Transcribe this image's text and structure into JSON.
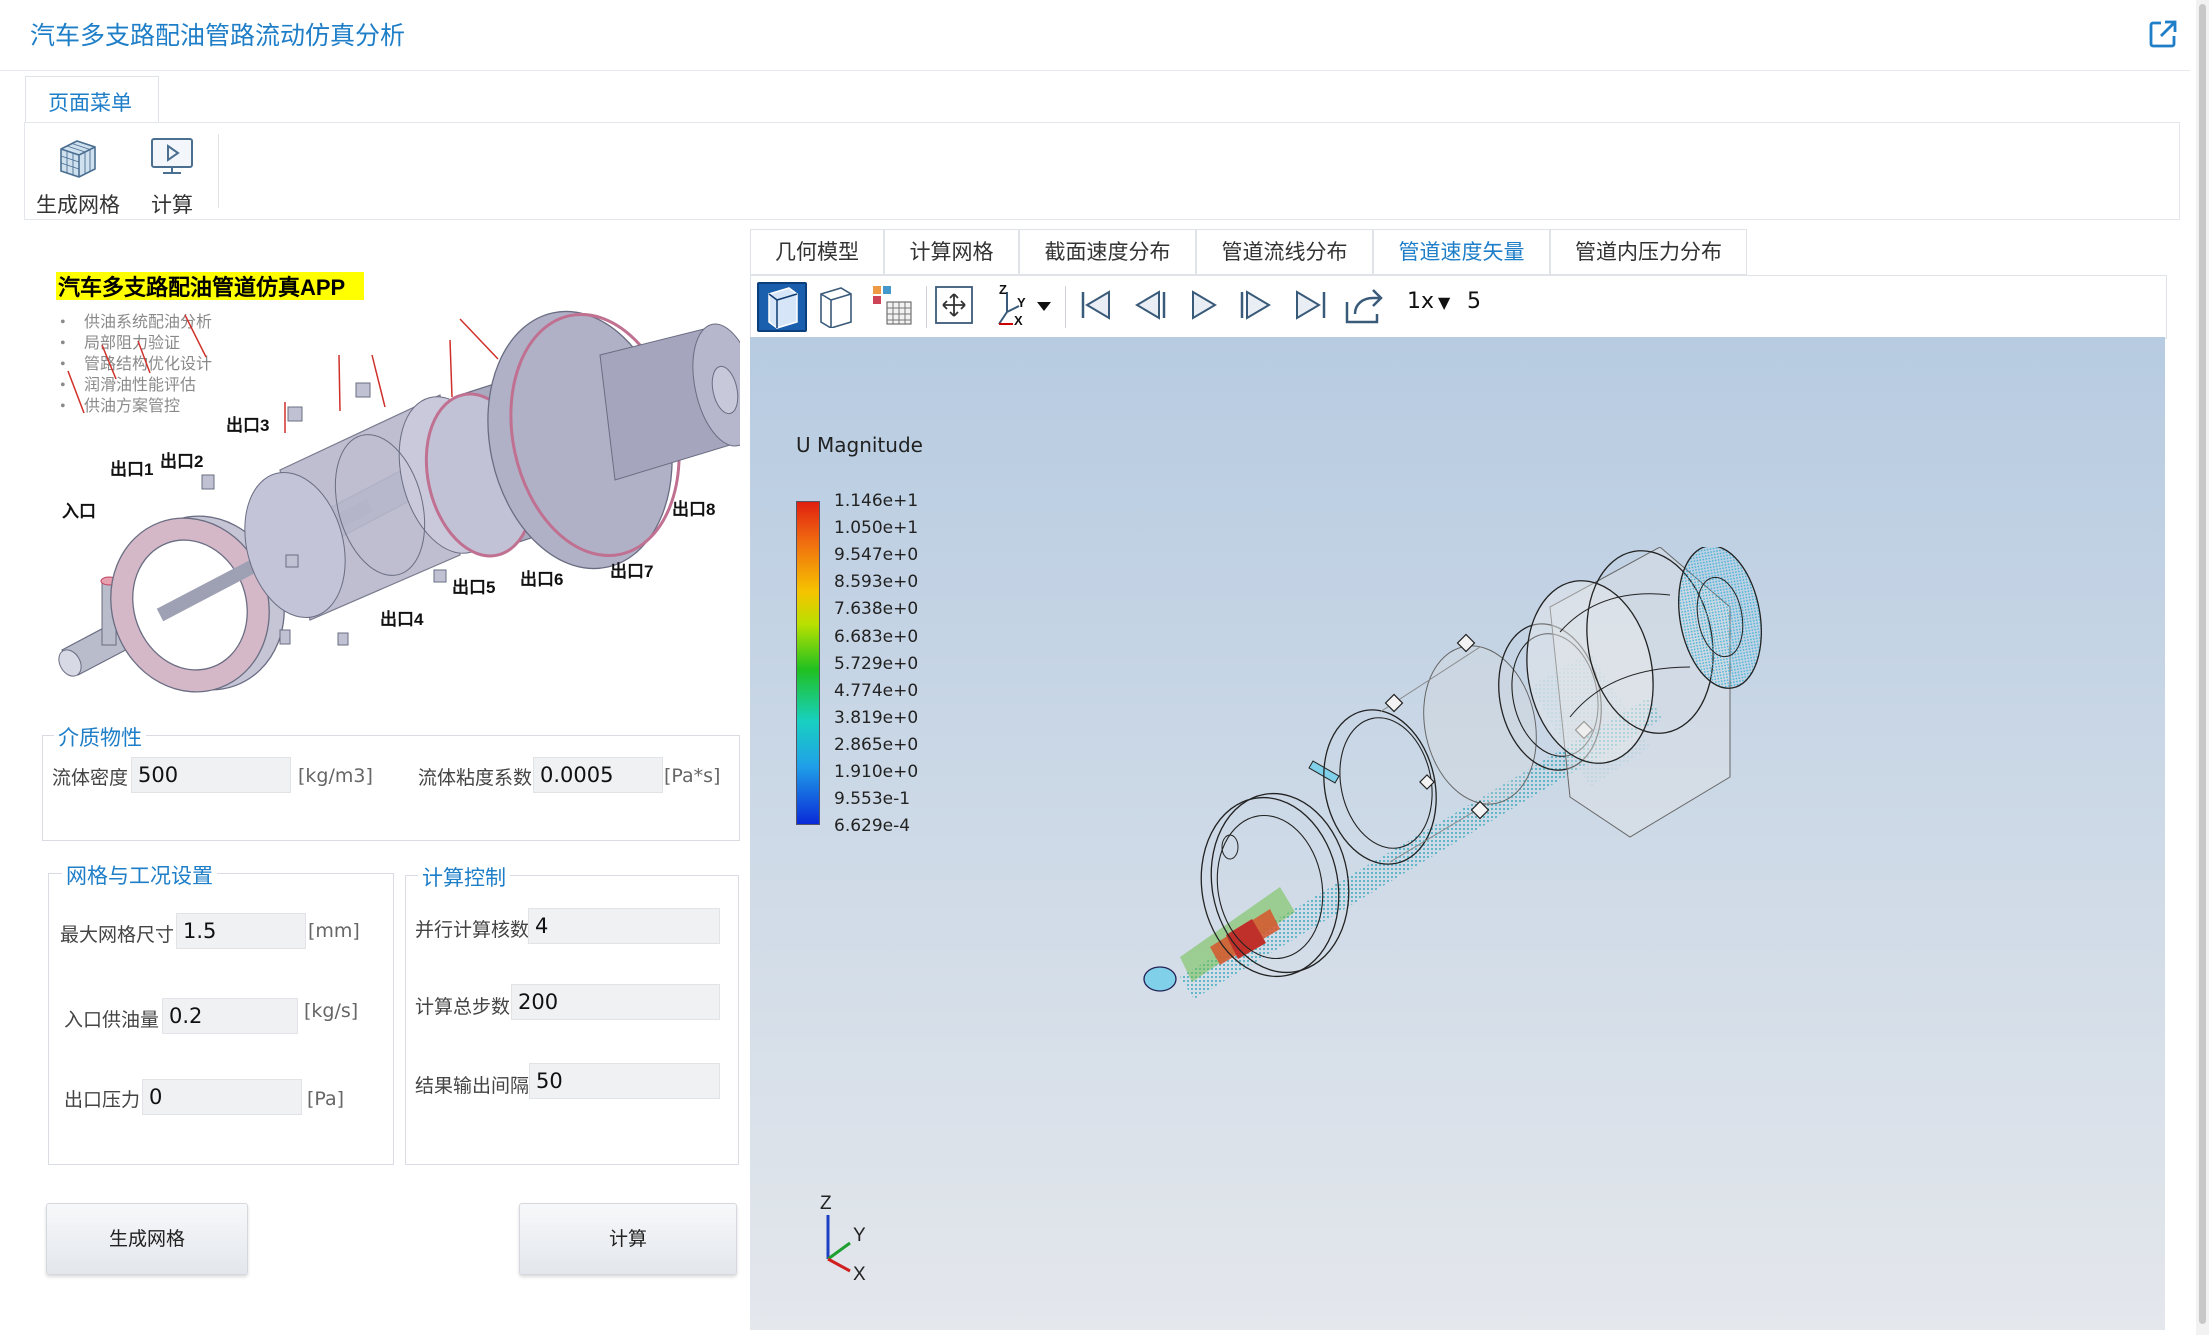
{
  "app": {
    "title": "汽车多支路配油管路流动仿真分析"
  },
  "menu": {
    "tab_label": "页面菜单",
    "buttons": [
      {
        "label": "生成网格",
        "icon": "mesh-cube-icon"
      },
      {
        "label": "计算",
        "icon": "compute-monitor-icon"
      }
    ]
  },
  "intro": {
    "title": "汽车多支路配油管道仿真APP",
    "bullets": [
      "供油系统配油分析",
      "局部阻力验证",
      "管路结构优化设计",
      "润滑油性能评估",
      "供油方案管控"
    ],
    "labels": {
      "inlet": "入口",
      "out1": "出口1",
      "out2": "出口2",
      "out3": "出口3",
      "out4": "出口4",
      "out5": "出口5",
      "out6": "出口6",
      "out7": "出口7",
      "out8": "出口8"
    }
  },
  "medium": {
    "title": "介质物性",
    "density": {
      "label": "流体密度",
      "value": "500",
      "unit": "[kg/m3]"
    },
    "viscosity": {
      "label": "流体粘度系数",
      "value": "0.0005",
      "unit": "[Pa*s]"
    }
  },
  "mesh_settings": {
    "title": "网格与工况设置",
    "max_mesh": {
      "label": "最大网格尺寸",
      "value": "1.5",
      "unit": "[mm]"
    },
    "inlet_flow": {
      "label": "入口供油量",
      "value": "0.2",
      "unit": "[kg/s]"
    },
    "outlet_pressure": {
      "label": "出口压力",
      "value": "0",
      "unit": "[Pa]"
    }
  },
  "calc_control": {
    "title": "计算控制",
    "cores": {
      "label": "并行计算核数",
      "value": "4"
    },
    "total_steps": {
      "label": "计算总步数",
      "value": "200"
    },
    "output_interval": {
      "label": "结果输出间隔",
      "value": "50"
    }
  },
  "actions": {
    "mesh": "生成网格",
    "compute": "计算"
  },
  "result_tabs": {
    "items": [
      "几何模型",
      "计算网格",
      "截面速度分布",
      "管道流线分布",
      "管道速度矢量",
      "管道内压力分布"
    ],
    "active_index": 4
  },
  "toolbar": {
    "speed": "1x",
    "frame": "5",
    "axis_letters": {
      "z": "Z",
      "y": "Y",
      "x": "X"
    }
  },
  "viewer": {
    "legend_title": "U Magnitude",
    "legend_labels": [
      "1.146e+1",
      "1.050e+1",
      "9.547e+0",
      "8.593e+0",
      "7.638e+0",
      "6.683e+0",
      "5.729e+0",
      "4.774e+0",
      "3.819e+0",
      "2.865e+0",
      "1.910e+0",
      "9.553e-1",
      "6.629e-4"
    ],
    "colors": {
      "accent": "#1e7ec8",
      "active_tool": "#1a5fae"
    }
  }
}
